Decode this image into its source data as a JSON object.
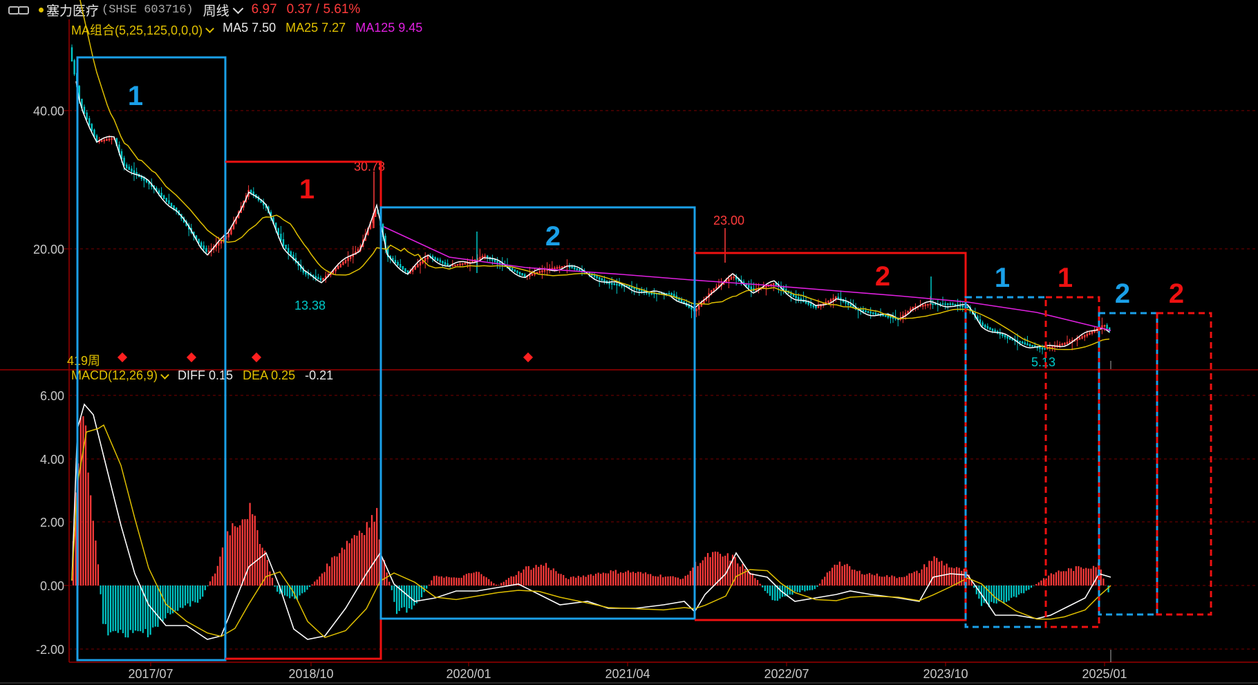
{
  "header": {
    "stock_name": "塞力医疗",
    "stock_code": "(SHSE 603716)",
    "period": "周线",
    "price": "6.97",
    "change": "0.37 / 5.61%"
  },
  "ma_panel": {
    "indicator": "MA组合(5,25,125,0,0,0)",
    "ma5": "MA5 7.50",
    "ma25": "MA25 7.27",
    "ma125": "MA125 9.45",
    "weeks_label": "419周",
    "labels": {
      "high1": "30.78",
      "low1": "13.38",
      "high2": "23.00",
      "low2": "5.13"
    },
    "y_ticks": [
      "40.00",
      "20.00"
    ]
  },
  "macd_panel": {
    "indicator": "MACD(12,26,9)",
    "diff": "DIFF 0.15",
    "dea": "DEA 0.25",
    "macd": "-0.21",
    "y_ticks": [
      "6.00",
      "4.00",
      "2.00",
      "0.00",
      "-2.00"
    ]
  },
  "x_axis": [
    "2017/07",
    "2018/10",
    "2020/01",
    "2021/04",
    "2022/07",
    "2023/10",
    "2025/01"
  ],
  "annotations": [
    "1",
    "1",
    "2",
    "2",
    "1",
    "1",
    "2",
    "2"
  ],
  "colors": {
    "up": "#ff3b3b",
    "down": "#00c8c8",
    "ma5": "#ffffff",
    "ma25": "#e0c000",
    "ma125": "#e020e0",
    "blue_box": "#1aa0e8",
    "red_box": "#ee1111",
    "grid": "#7a0000"
  },
  "chart_data": [
    {
      "type": "line",
      "title": "",
      "x": [
        "2017/07",
        "2018/10",
        "2020/01",
        "2021/04",
        "2022/07",
        "2023/10",
        "2025/01"
      ],
      "series": [
        {
          "name": "MA5",
          "values": [
            28.5,
            20.5,
            17.5,
            14.8,
            16.0,
            12.2,
            7.5
          ]
        },
        {
          "name": "MA25",
          "values": [
            29.0,
            21.5,
            17.8,
            15.5,
            15.5,
            12.5,
            7.27
          ]
        },
        {
          "name": "MA125",
          "values": [
            null,
            null,
            18.5,
            17.0,
            15.8,
            13.5,
            9.45
          ]
        }
      ],
      "y_ticks": [
        20,
        40
      ],
      "ylim": [
        0,
        50
      ],
      "annotations": [
        "30.78",
        "13.38",
        "23.00",
        "5.13"
      ]
    },
    {
      "type": "bar",
      "title": "",
      "x": [
        "2017/07",
        "2018/10",
        "2020/01",
        "2021/04",
        "2022/07",
        "2023/10",
        "2025/01"
      ],
      "series": [
        {
          "name": "DIFF",
          "values": [
            -1.4,
            -1.5,
            -0.3,
            -0.5,
            0.4,
            0.0,
            0.15
          ]
        },
        {
          "name": "DEA",
          "values": [
            -1.0,
            -1.3,
            -0.2,
            -0.4,
            0.2,
            0.0,
            0.25
          ]
        }
      ],
      "y_ticks": [
        -2,
        0,
        2,
        4,
        6
      ],
      "ylim": [
        -2.5,
        6.5
      ]
    }
  ]
}
